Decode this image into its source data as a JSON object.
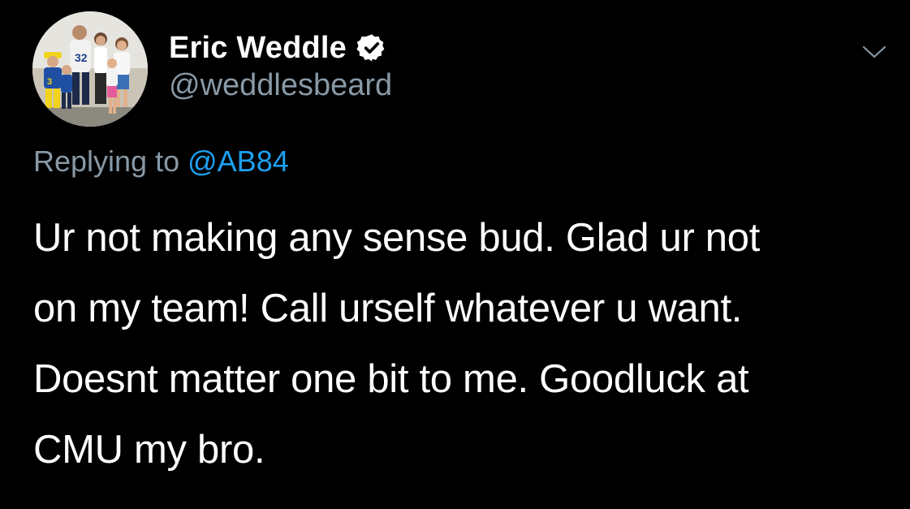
{
  "author": {
    "display_name": "Eric Weddle",
    "handle": "@weddlesbeard",
    "verified": true,
    "avatar_icon": "profile-photo-family-icon"
  },
  "reply": {
    "prefix": "Replying to",
    "mention": "@AB84"
  },
  "tweet": {
    "text": "Ur not making any sense bud. Glad ur not\non my team! Call urself whatever u want.\nDoesnt matter one bit to me. Goodluck at\nCMU my bro."
  },
  "menu": {
    "icon": "chevron-down-icon"
  },
  "colors": {
    "background": "#000000",
    "text": "#ffffff",
    "secondary": "#8899a6",
    "accent": "#1da1f2"
  }
}
